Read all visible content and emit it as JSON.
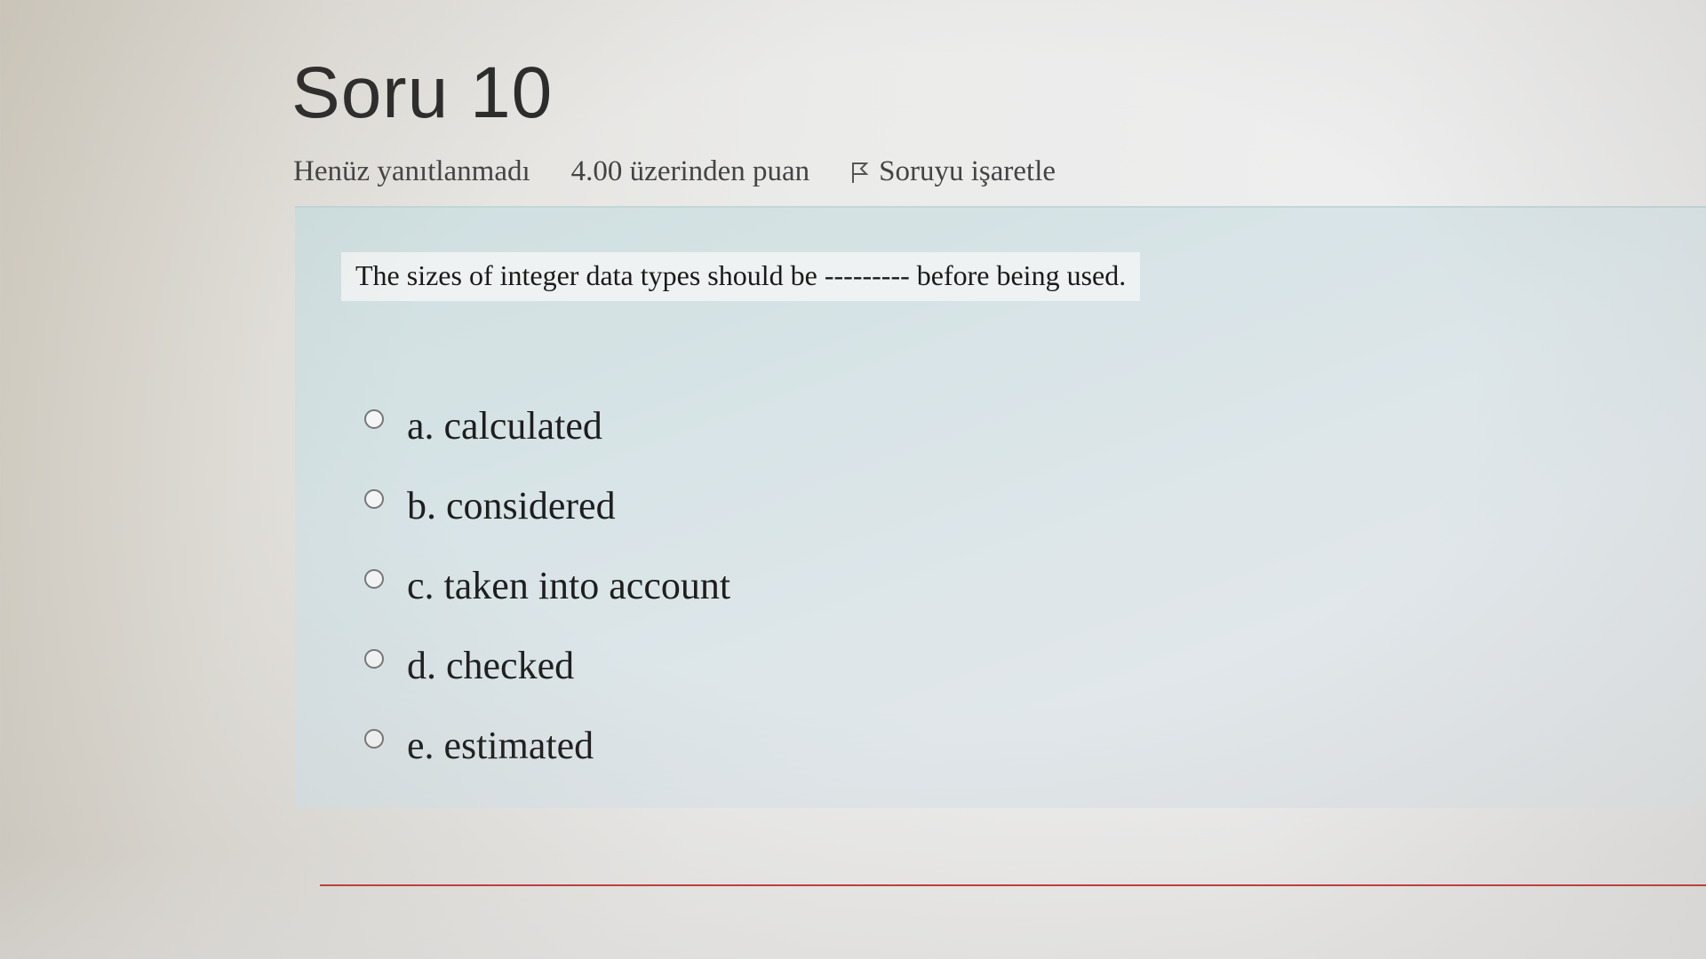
{
  "question": {
    "title": "Soru 10",
    "status": "Henüz yanıtlanmadı",
    "points": "4.00 üzerinden puan",
    "flag_label": "Soruyu işaretle",
    "text": "The sizes of integer data types should be --------- before being used.",
    "answers": [
      {
        "label": "a. calculated"
      },
      {
        "label": "b. considered"
      },
      {
        "label": "c. taken into account"
      },
      {
        "label": "d. checked"
      },
      {
        "label": "e. estimated"
      }
    ]
  },
  "icons": {
    "flag": "flag-icon",
    "radio": "radio-unchecked"
  },
  "colors": {
    "question_box": "#d8e4e7",
    "separator": "#c53b3b"
  }
}
